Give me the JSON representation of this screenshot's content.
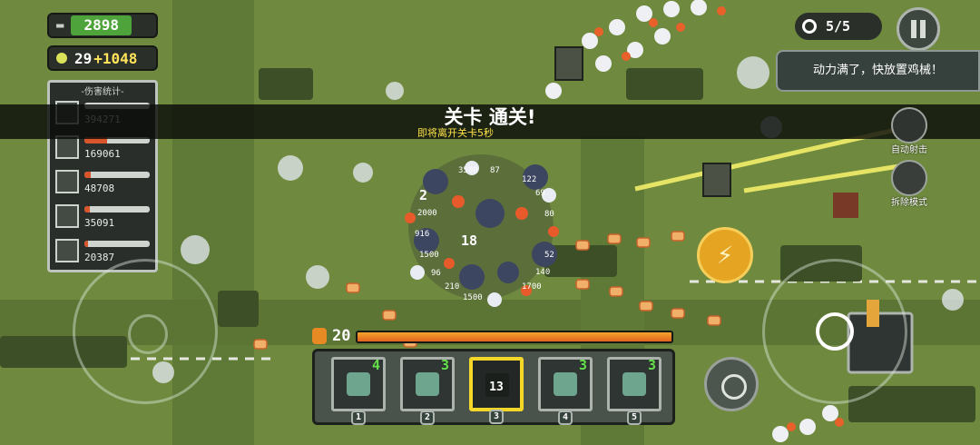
{
  "hud": {
    "money": "2898",
    "gems": "29",
    "gem_bonus": "+1048",
    "wave": "5/5"
  },
  "damage_stats": {
    "title": "-伤害统计-",
    "rows": [
      {
        "icon": "tank-unit-icon",
        "value": "394271",
        "fill": 0
      },
      {
        "icon": "shark-unit-icon",
        "value": "169061",
        "fill": 0.35
      },
      {
        "icon": "robot-unit-icon",
        "value": "48708",
        "fill": 0.1
      },
      {
        "icon": "barrel-unit-icon",
        "value": "35091",
        "fill": 0.08
      },
      {
        "icon": "chicken-unit-icon",
        "value": "20387",
        "fill": 0.05
      }
    ]
  },
  "banner": {
    "title": "关卡 通关!",
    "subtitle": "即将离开关卡5秒"
  },
  "hint": "动力满了，快放置鸡械！",
  "side_buttons": {
    "auto_fire": "自动射击",
    "demolish": "拆除模式"
  },
  "energy": {
    "value": "20",
    "fill": 1.0
  },
  "cards": [
    {
      "slot": "1",
      "count": "4",
      "icon": "shark-turret-icon",
      "cooldown": ""
    },
    {
      "slot": "2",
      "count": "3",
      "icon": "robot-chicken-icon",
      "cooldown": ""
    },
    {
      "slot": "3",
      "count": "",
      "icon": "bomb-icon",
      "cooldown": "13",
      "selected": true
    },
    {
      "slot": "4",
      "count": "3",
      "icon": "robot-chicken-icon",
      "cooldown": ""
    },
    {
      "slot": "5",
      "count": "3",
      "icon": "robot-chicken-icon",
      "cooldown": ""
    }
  ],
  "colors": {
    "grass": "#6f8a3e",
    "road": "#5a7234",
    "energy_orange": "#e0621e",
    "card_selected": "#f5d72a",
    "laser": "#f3ee6a"
  }
}
